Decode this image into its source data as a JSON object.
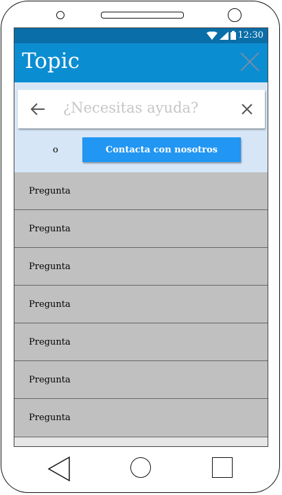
{
  "status_bar": {
    "time": "12:30",
    "icons": [
      "wifi-icon",
      "signal-icon",
      "battery-icon"
    ]
  },
  "app_bar": {
    "title": "Topic",
    "close_icon": "close-icon"
  },
  "search": {
    "placeholder": "¿Necesitas ayuda?",
    "value": "",
    "back_icon": "arrow-left-icon",
    "clear_icon": "clear-icon"
  },
  "contact": {
    "or_label": "o",
    "button_label": "Contacta con nosotros"
  },
  "questions": [
    {
      "label": "Pregunta"
    },
    {
      "label": "Pregunta"
    },
    {
      "label": "Pregunta"
    },
    {
      "label": "Pregunta"
    },
    {
      "label": "Pregunta"
    },
    {
      "label": "Pregunta"
    },
    {
      "label": "Pregunta"
    }
  ],
  "nav_bar": {
    "icons": [
      "back-triangle-icon",
      "home-circle-icon",
      "recent-square-icon"
    ]
  },
  "colors": {
    "status_bar": "#0a6ea8",
    "app_bar": "#0b8dd1",
    "search_area": "#d6e6f7",
    "button": "#2196f3",
    "list_item": "#c0c0c0"
  }
}
